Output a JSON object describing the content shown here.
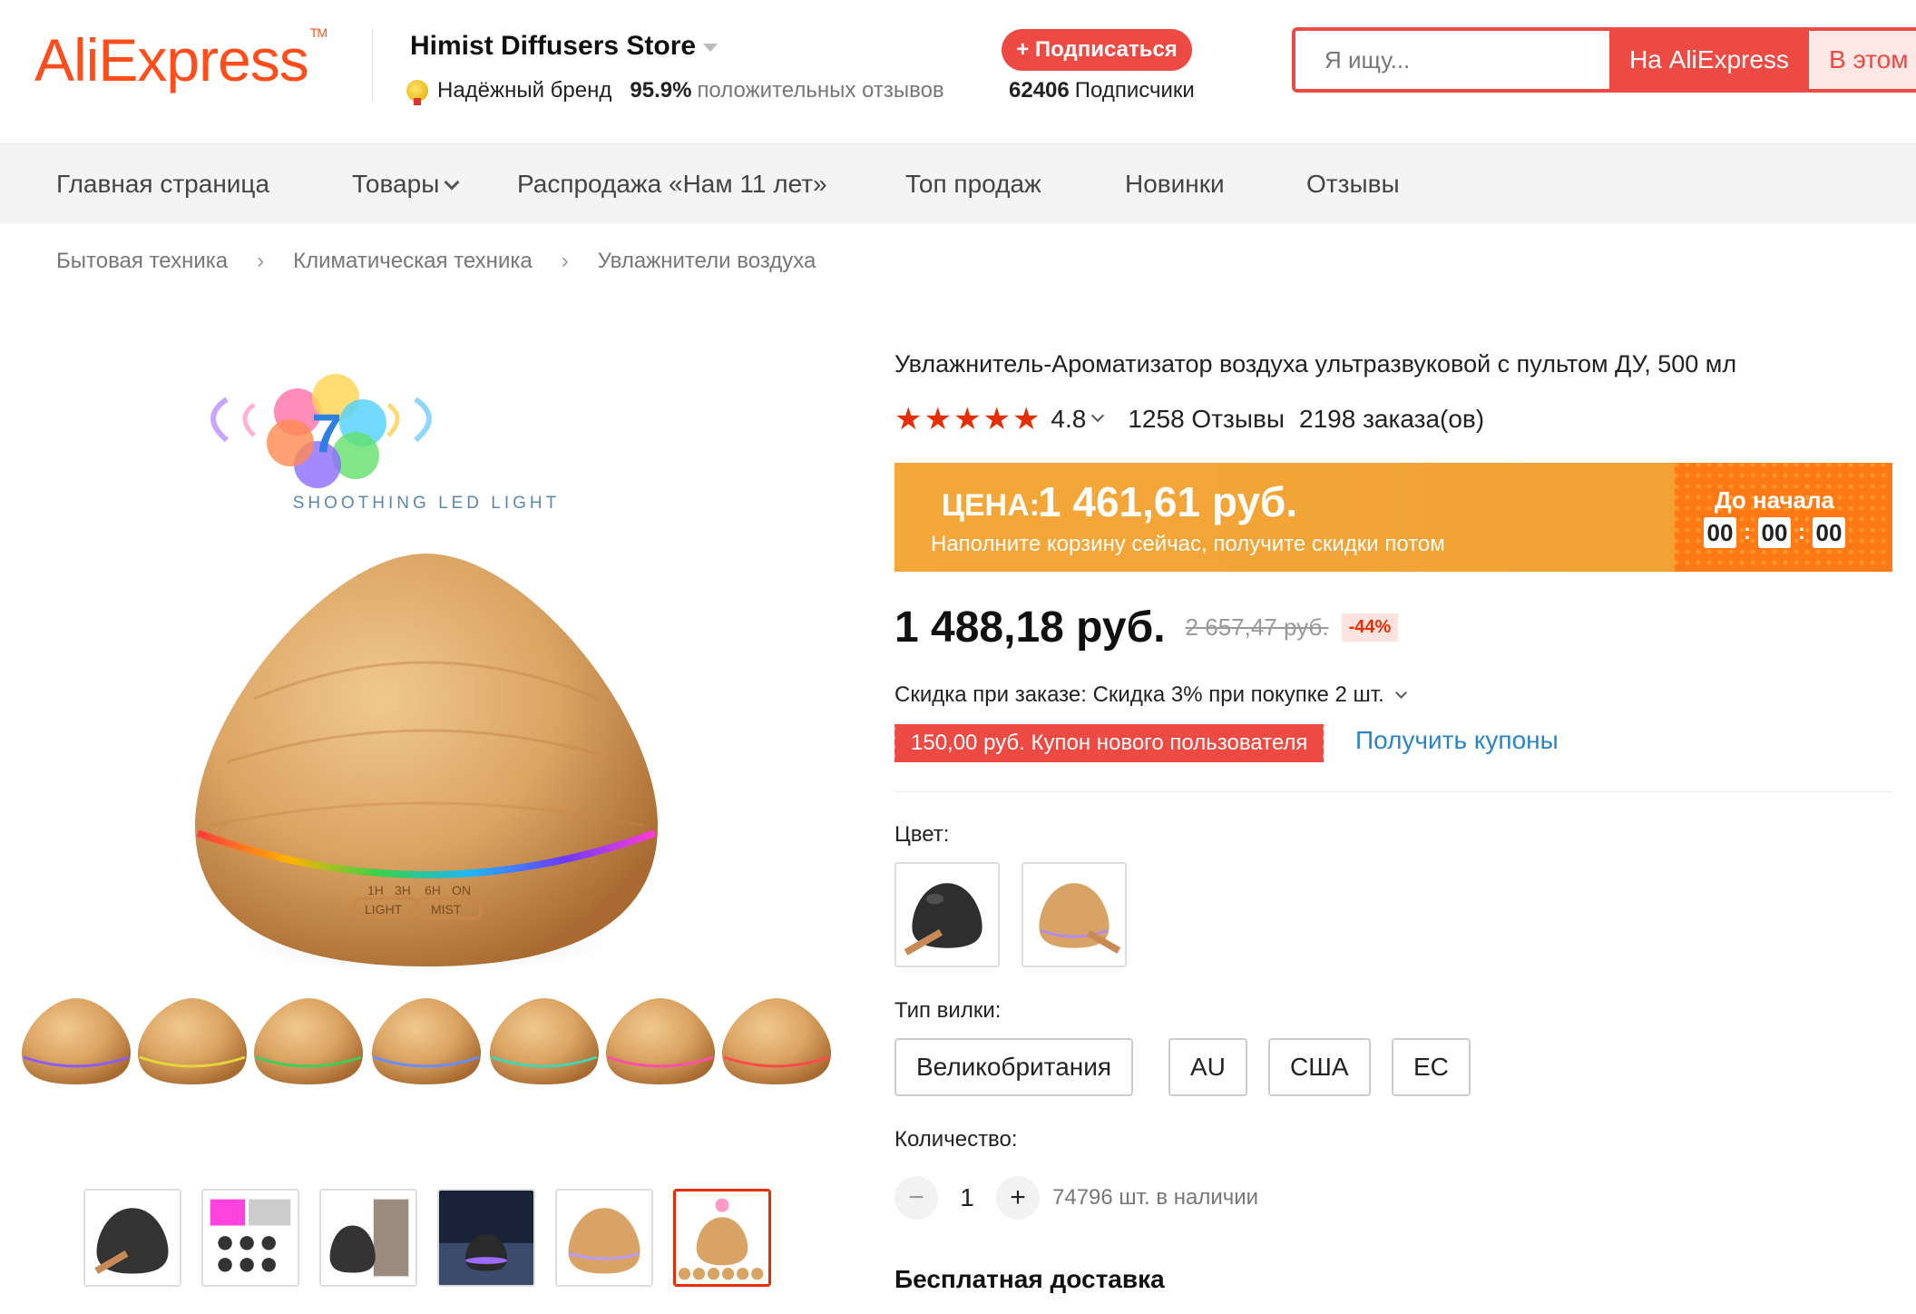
{
  "header": {
    "logo_text": "AliExpress",
    "logo_tm": "TM",
    "store_name": "Himist Diffusers Store",
    "brand_badge": "Надёжный бренд",
    "rating_percent": "95.9%",
    "rating_text": "положительных отзывов",
    "subscribe_label": "+ Подписаться",
    "followers_count": "62406",
    "followers_label": "Подписчики",
    "search_placeholder": "Я ищу...",
    "search_aliexpress_label": "На AliExpress",
    "search_store_label": "В этом"
  },
  "nav": {
    "items": [
      "Главная страница",
      "Товары",
      "Распродажа «Нам 11 лет»",
      "Топ продаж",
      "Новинки",
      "Отзывы"
    ]
  },
  "breadcrumb": [
    "Бытовая техника",
    "Климатическая техника",
    "Увлажнители воздуха"
  ],
  "gallery": {
    "banner_text": "SHOOTHING LED LIGHT",
    "badge_number": "7",
    "panel_labels": [
      "1H",
      "3H",
      "6H",
      "ON",
      "LIGHT",
      "MIST"
    ],
    "thumb_count": 6,
    "active_thumb": 6
  },
  "product": {
    "title": "Увлажнитель-Ароматизатор воздуха ультразвуковой с пультом ДУ, 500 мл",
    "rating": "4.8",
    "reviews": "1258 Отзывы",
    "orders": "2198 заказа(ов)",
    "promo": {
      "price_label": "ЦЕНА:",
      "price_value": "1 461,61 руб.",
      "note": "Наполните корзину сейчас, получите скидки потом",
      "start_label": "До начала",
      "hours": "00",
      "minutes": "00",
      "seconds": "00"
    },
    "price": "1 488,18 руб.",
    "old_price": "2 657,47 руб.",
    "discount": "-44%",
    "bulk_discount": "Скидка при заказе: Скидка 3% при покупке 2 шт.",
    "coupon": "150,00 руб. Купон нового пользователя",
    "get_coupons": "Получить купоны",
    "color_label": "Цвет:",
    "plug_label": "Тип вилки:",
    "plug_options": [
      "Великобритания",
      "AU",
      "США",
      "EC"
    ],
    "quantity_label": "Количество:",
    "quantity": "1",
    "stock": "74796 шт. в наличии",
    "shipping": "Бесплатная доставка"
  },
  "colors": {
    "brand": "#ff4e1c",
    "accent_red": "#ee4a44",
    "promo_orange": "#f5a73a",
    "link_blue": "#2a85c8",
    "wood": "#d9a366"
  }
}
